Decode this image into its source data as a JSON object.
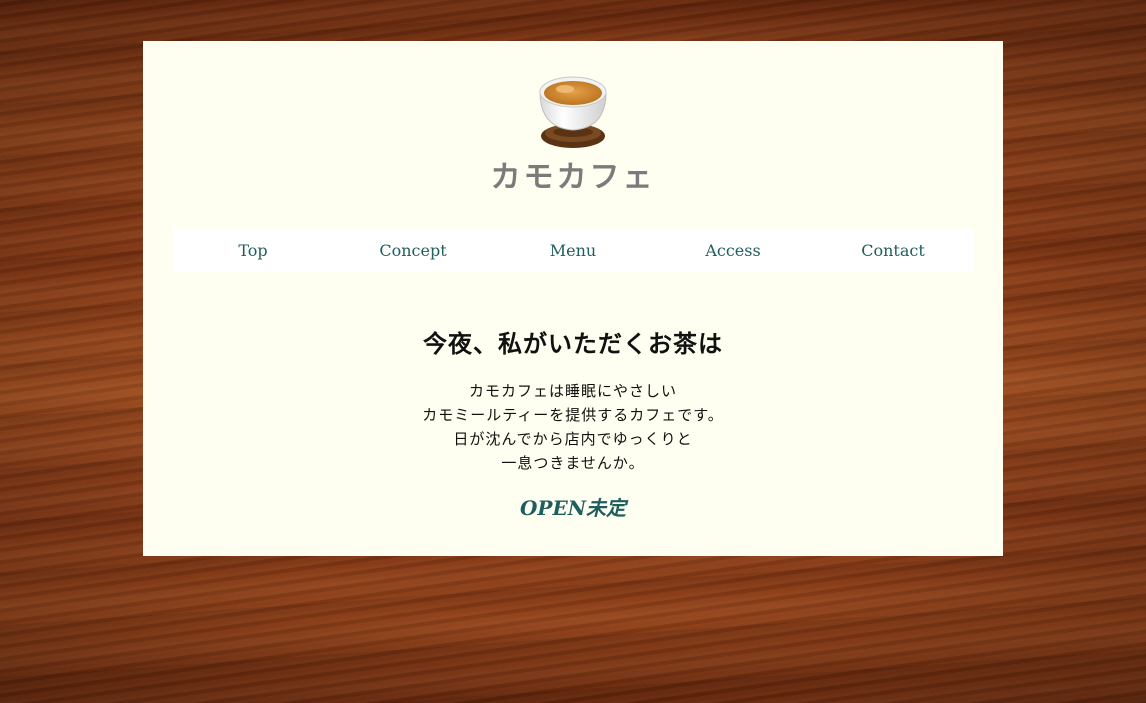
{
  "site": {
    "title": "カモカフェ",
    "logo_icon": "teacup-icon"
  },
  "nav": {
    "items": [
      {
        "label": "Top"
      },
      {
        "label": "Concept"
      },
      {
        "label": "Menu"
      },
      {
        "label": "Access"
      },
      {
        "label": "Contact"
      }
    ]
  },
  "main": {
    "headline": "今夜、私がいただくお茶は",
    "description": [
      "カモカフェは睡眠にやさしい",
      "カモミールティーを提供するカフェです。",
      "日が沈んでから店内でゆっくりと",
      "一息つきませんか。"
    ],
    "open_status": "OPEN未定"
  },
  "colors": {
    "card_background": "#fefff0",
    "nav_background": "#ffffff",
    "accent": "#1f5e5e",
    "title": "#7b7b7b",
    "wood": "#7a3514"
  }
}
